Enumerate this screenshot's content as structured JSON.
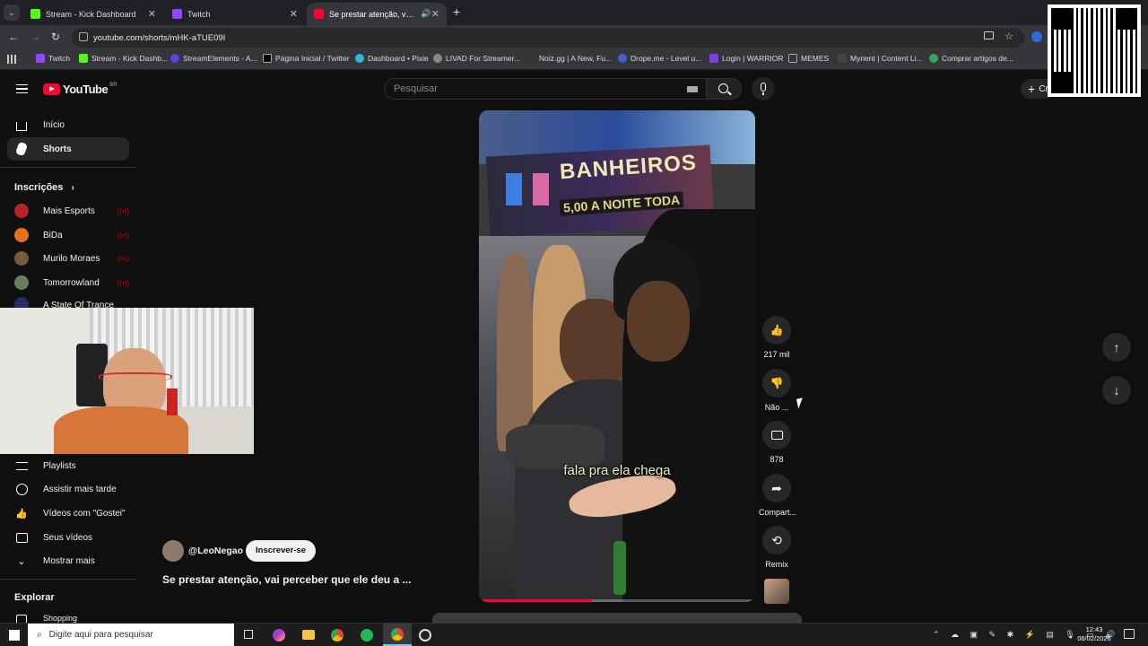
{
  "browser": {
    "tabs": [
      {
        "title": "Stream - Kick Dashboard",
        "color": "#53fc18",
        "active": false
      },
      {
        "title": "Twitch",
        "color": "#9146ff",
        "active": false
      },
      {
        "title": "Se prestar atenção, vai pere",
        "color": "#ff0033",
        "active": true
      }
    ],
    "url": "youtube.com/shorts/mHK-aTUE09I",
    "bookmarks": [
      {
        "label": "Twitch",
        "color": "#9146ff"
      },
      {
        "label": "Stream - Kick Dashb...",
        "color": "#53fc18"
      },
      {
        "label": "StreamElements - A...",
        "color": "#5046e4"
      },
      {
        "label": "Página Inicial / Twitter",
        "color": "#000000"
      },
      {
        "label": "Dashboard • Pixie",
        "color": "#2db8d8"
      },
      {
        "label": "LIVAD For Streamer...",
        "color": "#888888"
      },
      {
        "label": "Noiz.gg | A New, Fu...",
        "color": "#333333"
      },
      {
        "label": "Drope.me - Level u...",
        "color": "#4a5bd4"
      },
      {
        "label": "Login | WARRIOR",
        "color": "#7b3fe4"
      },
      {
        "label": "MEMES",
        "color": "#aaaaaa"
      },
      {
        "label": "Myrient | Content Li...",
        "color": "#444444"
      },
      {
        "label": "Comprar artigos de...",
        "color": "#34a853"
      }
    ]
  },
  "youtube": {
    "logo": "YouTube",
    "region": "BR",
    "search_placeholder": "Pesquisar",
    "create_label": "Cr",
    "sidebar": {
      "home": "Início",
      "shorts": "Shorts",
      "subscriptions_title": "Inscrições",
      "channels": [
        {
          "name": "Mais Esports",
          "color": "#b5232b"
        },
        {
          "name": "BiDa",
          "color": "#e2731c"
        },
        {
          "name": "Murilo Moraes",
          "color": "#7a5b3d"
        },
        {
          "name": "Tomorrowland",
          "color": "#6b7f5c"
        },
        {
          "name": "A State Of Trance",
          "color": "#2b2b6b"
        }
      ],
      "you_items": [
        "Playlists",
        "Assistir mais tarde",
        "Vídeos com \"Gostei\"",
        "Seus vídeos",
        "Mostrar mais"
      ],
      "explore_title": "Explorar",
      "explore_items": [
        "Shopping"
      ]
    },
    "short": {
      "channel": "@LeoNegao",
      "subscribe": "Inscrever-se",
      "title": "Se prestar atenção, vai perceber que ele deu a ...",
      "caption": "fala pra ela chega",
      "sign_line1": "BANHEIROS",
      "sign_line2": "5,00 A NOITE TODA",
      "progress": 0.41,
      "actions": {
        "like": "217 mil",
        "dislike": "Não ...",
        "comments": "878",
        "share": "Compart...",
        "remix": "Remix"
      }
    }
  },
  "taskbar": {
    "search_placeholder": "Digite aqui para pesquisar",
    "time": "12:43",
    "date": "06/02/2026"
  }
}
